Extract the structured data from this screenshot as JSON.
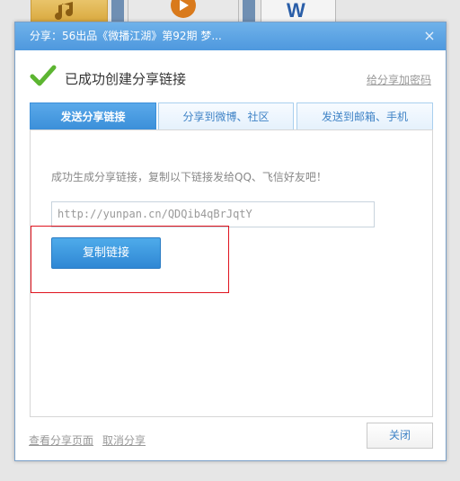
{
  "background": {
    "icons": [
      "music-file-icon",
      "video-file-icon",
      "word-file-icon"
    ]
  },
  "dialog": {
    "title": "分享：56出品《微播江湖》第92期 梦...",
    "close_icon": "×",
    "header": {
      "title": "已成功创建分享链接",
      "password_link": "给分享加密码"
    },
    "tabs": [
      {
        "label": "发送分享链接",
        "active": true
      },
      {
        "label": "分享到微博、社区",
        "active": false
      },
      {
        "label": "发送到邮箱、手机",
        "active": false
      }
    ],
    "panel": {
      "description": "成功生成分享链接，复制以下链接发给QQ、飞信好友吧！",
      "link_value": "http://yunpan.cn/QDQib4qBrJqtY",
      "copy_button": "复制链接"
    },
    "footer": {
      "view_page": "查看分享页面",
      "cancel_share": "取消分享",
      "close_button": "关闭"
    }
  },
  "colors": {
    "accent": "#3b8fd9",
    "highlight": "#e0141e",
    "check": "#5cb531"
  }
}
